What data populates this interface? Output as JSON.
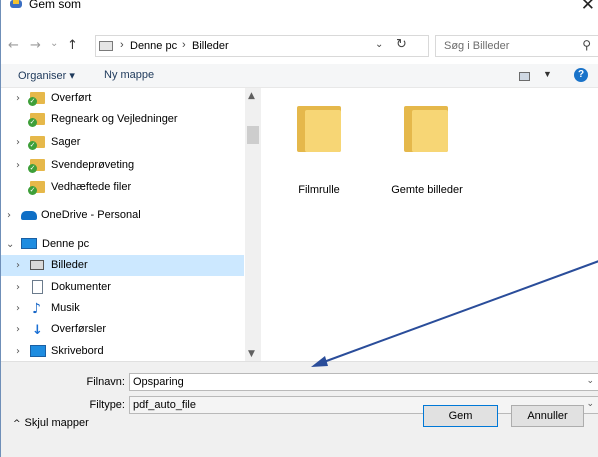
{
  "window": {
    "title": "Gem som",
    "close_glyph": "✕"
  },
  "nav": {
    "back_glyph": "←",
    "forward_glyph": "→",
    "recent_glyph": "⌄",
    "up_glyph": "↑",
    "breadcrumb": [
      "Denne pc",
      "Billeder"
    ],
    "crumb_sep": "›",
    "refresh_glyph": "↻",
    "dropdown_glyph": "⌄"
  },
  "search": {
    "placeholder": "Søg i Billeder",
    "icon": "search-icon"
  },
  "toolbar": {
    "organize": "Organiser ▾",
    "new_folder": "Ny mappe",
    "help": "?"
  },
  "tree": [
    {
      "label": "Overført",
      "icon": "folder-sync-icon",
      "expandable": true
    },
    {
      "label": "Regneark og Vejledninger",
      "icon": "folder-sync-icon",
      "expandable": false
    },
    {
      "label": "Sager",
      "icon": "folder-sync-icon",
      "expandable": true
    },
    {
      "label": "Svendeprøveting",
      "icon": "folder-sync-icon",
      "expandable": true
    },
    {
      "label": "Vedhæftede filer",
      "icon": "folder-sync-icon",
      "expandable": false
    },
    {
      "label": "OneDrive - Personal",
      "icon": "onedrive-icon",
      "expandable": true
    },
    {
      "label": "Denne pc",
      "icon": "pc-icon",
      "expandable": true,
      "expanded": true
    },
    {
      "label": "Billeder",
      "icon": "pictures-icon",
      "expandable": true,
      "selected": true
    },
    {
      "label": "Dokumenter",
      "icon": "documents-icon",
      "expandable": true
    },
    {
      "label": "Musik",
      "icon": "music-icon",
      "expandable": true
    },
    {
      "label": "Overførsler",
      "icon": "downloads-icon",
      "expandable": true
    },
    {
      "label": "Skrivebord",
      "icon": "desktop-icon",
      "expandable": true
    }
  ],
  "folders": [
    {
      "label": "Filmrulle",
      "icon": "folder-icon"
    },
    {
      "label": "Gemte billeder",
      "icon": "folder-icon"
    }
  ],
  "form": {
    "filename_label": "Filnavn:",
    "filename_value": "Opsparing",
    "filetype_label": "Filtype:",
    "filetype_value": "pdf_auto_file"
  },
  "footer": {
    "hide_folders": "Skjul mapper",
    "hide_glyph": "^",
    "save": "Gem",
    "cancel": "Annuller"
  },
  "colors": {
    "selection": "#cce8ff",
    "accent": "#0078d7",
    "annotation_arrow": "#2a4d9a",
    "folder": "#f7d675"
  }
}
